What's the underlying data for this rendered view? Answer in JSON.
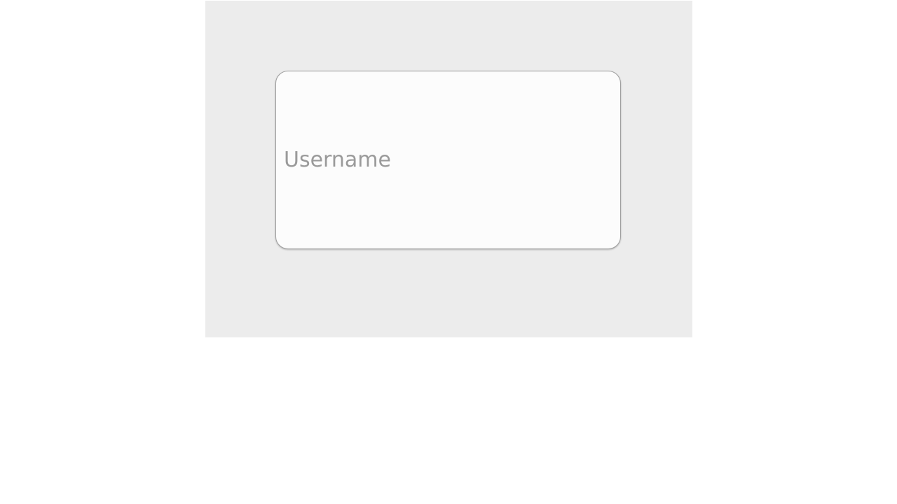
{
  "login_form": {
    "username_field": {
      "value": "",
      "placeholder": "Username"
    }
  },
  "colors": {
    "page_background": "#ffffff",
    "panel_background": "#ececec",
    "input_background": "#fcfcfc",
    "input_border": "#9e9e9e",
    "placeholder_text": "#9a9a9a"
  }
}
